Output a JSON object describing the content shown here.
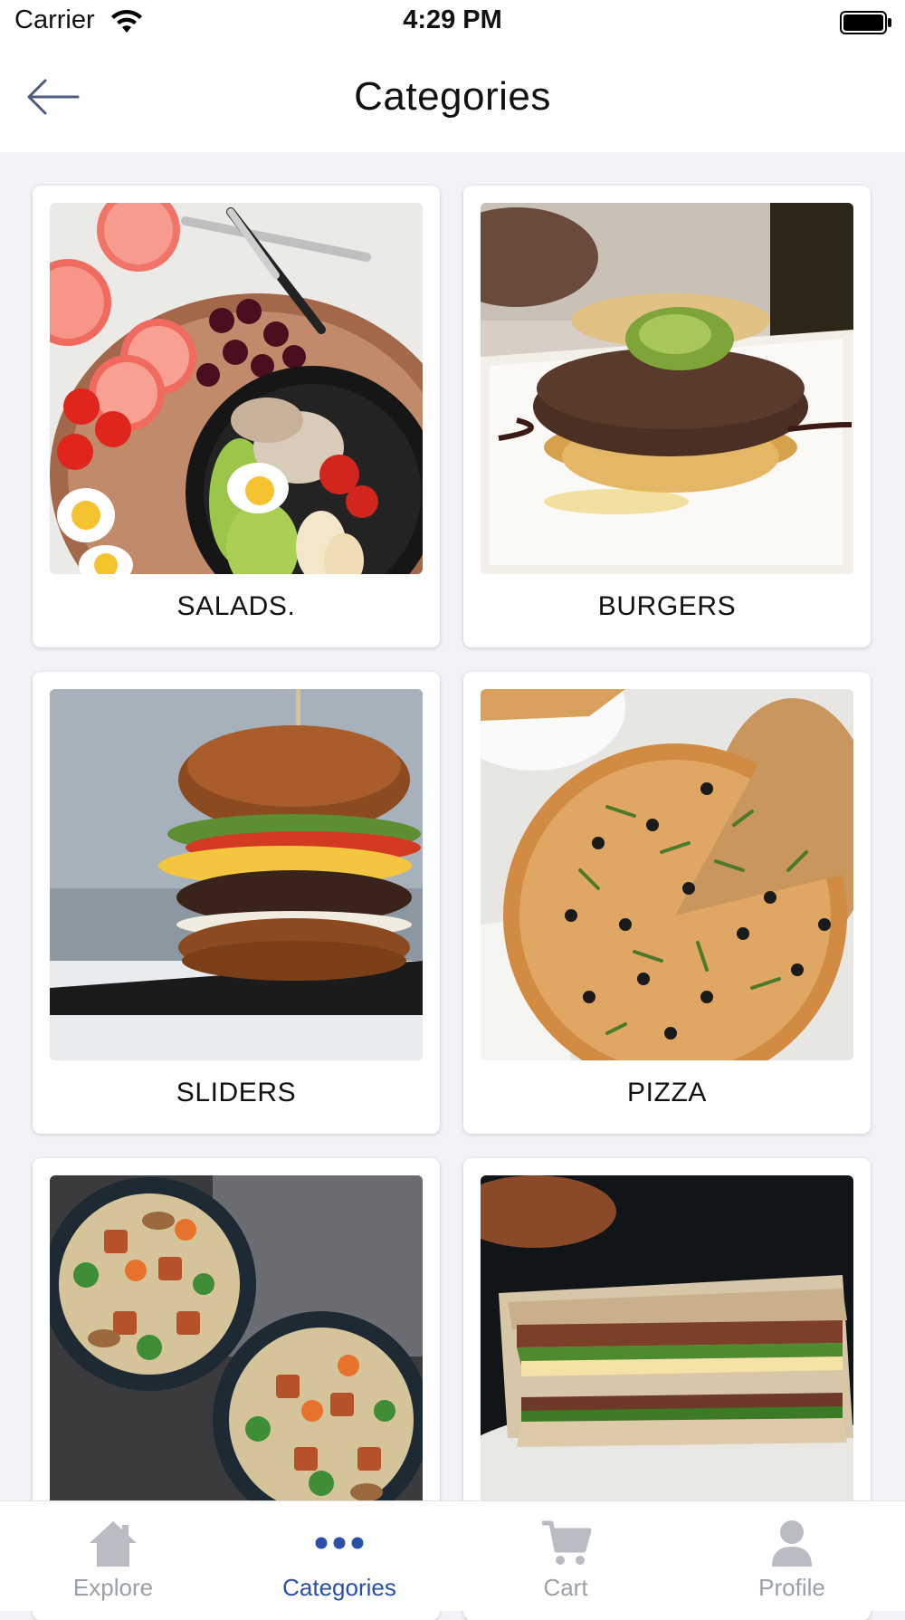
{
  "status_bar": {
    "carrier": "Carrier",
    "time": "4:29 PM"
  },
  "nav": {
    "title": "Categories",
    "back_icon": "arrow-left-icon"
  },
  "categories": [
    {
      "label": "SALADS."
    },
    {
      "label": "BURGERS"
    },
    {
      "label": "SLIDERS"
    },
    {
      "label": "PIZZA"
    },
    {
      "label": ""
    },
    {
      "label": ""
    }
  ],
  "tabs": [
    {
      "label": "Explore",
      "icon": "home-icon",
      "active": false
    },
    {
      "label": "Categories",
      "icon": "more-dots-icon",
      "active": true
    },
    {
      "label": "Cart",
      "icon": "cart-icon",
      "active": false
    },
    {
      "label": "Profile",
      "icon": "user-icon",
      "active": false
    }
  ],
  "colors": {
    "accent": "#2a4fa8",
    "inactive_tab": "#9aa0a8",
    "background": "#f2f3f7"
  }
}
